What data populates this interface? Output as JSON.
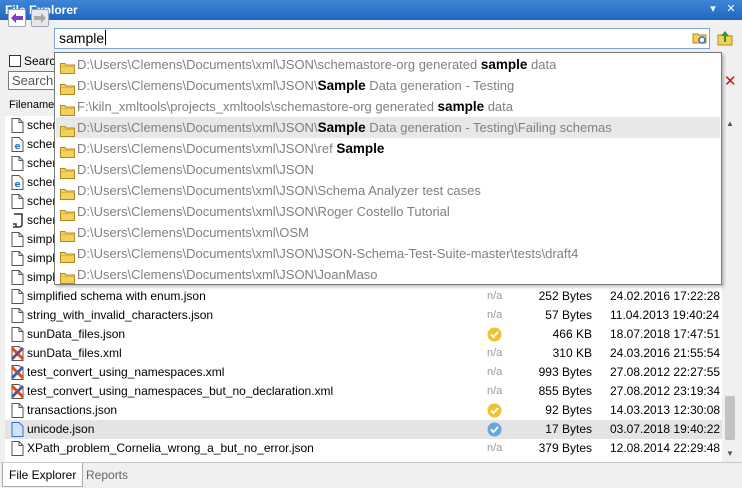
{
  "window": {
    "title": "File Explorer",
    "pin_glyph": "▾",
    "close_glyph": "✕"
  },
  "toolbar": {
    "back_icon": "back-arrow-icon",
    "forward_icon": "forward-arrow-icon",
    "path_value": "sample"
  },
  "filters": {
    "checkbox_label": "Search",
    "search_value": "Search",
    "clear_glyph": "✕"
  },
  "columns": {
    "filename": "Filename"
  },
  "files": [
    {
      "name": "schem",
      "icon": "file-icon",
      "status": "",
      "size": "",
      "date": ""
    },
    {
      "name": "schem",
      "icon": "ie-file-icon",
      "status": "",
      "size": "",
      "date": ""
    },
    {
      "name": "schem",
      "icon": "file-icon",
      "status": "",
      "size": "",
      "date": ""
    },
    {
      "name": "schem",
      "icon": "ie-file-icon",
      "status": "",
      "size": "",
      "date": ""
    },
    {
      "name": "schem",
      "icon": "file-icon",
      "status": "",
      "size": "",
      "date": ""
    },
    {
      "name": "schem",
      "icon": "script-file-icon",
      "status": "",
      "size": "",
      "date": ""
    },
    {
      "name": "simpli",
      "icon": "file-icon",
      "status": "",
      "size": "",
      "date": ""
    },
    {
      "name": "simpli",
      "icon": "file-icon",
      "status": "",
      "size": "",
      "date": ""
    },
    {
      "name": "simpli",
      "icon": "file-icon",
      "status": "",
      "size": "",
      "date": ""
    },
    {
      "name": "simplified schema with enum.json",
      "icon": "file-icon",
      "status": "n/a",
      "size": "252 Bytes",
      "date": "24.02.2016 17:22:28"
    },
    {
      "name": "string_with_invalid_characters.json",
      "icon": "file-icon",
      "status": "n/a",
      "size": "57 Bytes",
      "date": "11.04.2013 19:40:24"
    },
    {
      "name": "sunData_files.json",
      "icon": "file-icon",
      "status": "valid",
      "size": "466 KB",
      "date": "18.07.2018 17:47:51"
    },
    {
      "name": "sunData_files.xml",
      "icon": "xml-file-icon",
      "status": "n/a",
      "size": "310 KB",
      "date": "24.03.2016 21:55:54"
    },
    {
      "name": "test_convert_using_namespaces.xml",
      "icon": "xml-file-icon",
      "status": "n/a",
      "size": "993 Bytes",
      "date": "27.08.2012 22:27:55"
    },
    {
      "name": "test_convert_using_namespaces_but_no_declaration.xml",
      "icon": "xml-file-icon",
      "status": "n/a",
      "size": "855 Bytes",
      "date": "27.08.2012 23:19:34"
    },
    {
      "name": "transactions.json",
      "icon": "file-icon",
      "status": "valid",
      "size": "92 Bytes",
      "date": "14.03.2013 12:30:08"
    },
    {
      "name": "unicode.json",
      "icon": "json-file-icon",
      "status": "valid-selected",
      "size": "17 Bytes",
      "date": "03.07.2018 19:40:22"
    },
    {
      "name": "XPath_problem_Cornelia_wrong_a_but_no_error.json",
      "icon": "file-icon",
      "status": "n/a",
      "size": "379 Bytes",
      "date": "12.08.2014 22:29:48"
    }
  ],
  "dropdown": [
    {
      "pre": "D:\\Users\\Clemens\\Documents\\xml\\JSON\\schemastore-org generated ",
      "bold": "sample",
      "post": " data"
    },
    {
      "pre": "D:\\Users\\Clemens\\Documents\\xml\\JSON\\",
      "bold": "Sample",
      "post": " Data generation - Testing"
    },
    {
      "pre": "F:\\kiln_xmltools\\projects_xmltools\\schemastore-org generated ",
      "bold": "sample",
      "post": " data"
    },
    {
      "pre": "D:\\Users\\Clemens\\Documents\\xml\\JSON\\",
      "bold": "Sample",
      "post": " Data generation - Testing\\Failing schemas"
    },
    {
      "pre": "D:\\Users\\Clemens\\Documents\\xml\\JSON\\ref ",
      "bold": "Sample",
      "post": ""
    },
    {
      "pre": "D:\\Users\\Clemens\\Documents\\xml\\JSON",
      "bold": "",
      "post": ""
    },
    {
      "pre": "D:\\Users\\Clemens\\Documents\\xml\\JSON\\Schema Analyzer test cases",
      "bold": "",
      "post": ""
    },
    {
      "pre": "D:\\Users\\Clemens\\Documents\\xml\\JSON\\Roger Costello Tutorial",
      "bold": "",
      "post": ""
    },
    {
      "pre": "D:\\Users\\Clemens\\Documents\\xml\\OSM",
      "bold": "",
      "post": ""
    },
    {
      "pre": "D:\\Users\\Clemens\\Documents\\xml\\JSON\\JSON-Schema-Test-Suite-master\\tests\\draft4",
      "bold": "",
      "post": ""
    },
    {
      "pre": "D:\\Users\\Clemens\\Documents\\xml\\JSON\\JoanMaso",
      "bold": "",
      "post": ""
    }
  ],
  "tabs": [
    {
      "label": "File Explorer"
    },
    {
      "label": "Reports"
    }
  ],
  "colors": {
    "title_bar": "#2a74cc",
    "accent_border": "#7fa3d6",
    "valid_badge": "#f2c12e",
    "xml_x": "#e04a1a",
    "dropdown_text": "#808080"
  }
}
